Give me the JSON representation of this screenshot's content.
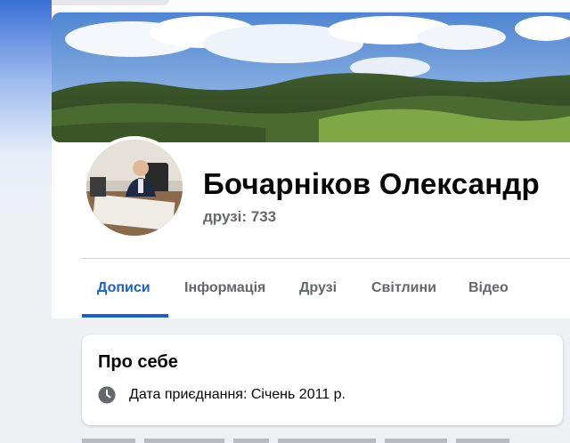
{
  "profile": {
    "name": "Бочарніков Олександр",
    "friends": "друзі: 733"
  },
  "tabs": [
    {
      "label": "Дописи",
      "active": true
    },
    {
      "label": "Інформація",
      "active": false
    },
    {
      "label": "Друзі",
      "active": false
    },
    {
      "label": "Світлини",
      "active": false
    },
    {
      "label": "Відео",
      "active": false
    }
  ],
  "about": {
    "title": "Про себе",
    "join_date": "Дата приєднання: Січень 2011 р.",
    "icon": "clock-icon"
  },
  "colors": {
    "accent": "#1b5fd1",
    "muted_text": "#65676b",
    "page_bg": "#eef0f3"
  }
}
